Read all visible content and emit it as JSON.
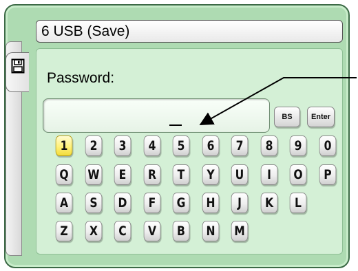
{
  "window": {
    "title": "6 USB (Save)"
  },
  "side_tab": {
    "icon": "floppy-disk-icon"
  },
  "password": {
    "label": "Password:",
    "value": "",
    "cursor": "_"
  },
  "buttons": {
    "backspace": "BS",
    "enter": "Enter"
  },
  "keyboard": {
    "active_key": "1",
    "rows": [
      [
        "1",
        "2",
        "3",
        "4",
        "5",
        "6",
        "7",
        "8",
        "9",
        "0"
      ],
      [
        "Q",
        "W",
        "E",
        "R",
        "T",
        "Y",
        "U",
        "I",
        "O",
        "P"
      ],
      [
        "A",
        "S",
        "D",
        "F",
        "G",
        "H",
        "J",
        "K",
        "L"
      ],
      [
        "Z",
        "X",
        "C",
        "V",
        "B",
        "N",
        "M"
      ]
    ]
  },
  "colors": {
    "frame": "#aedbb2",
    "panel": "#d4f0d6",
    "active_key": "#fff17a"
  }
}
